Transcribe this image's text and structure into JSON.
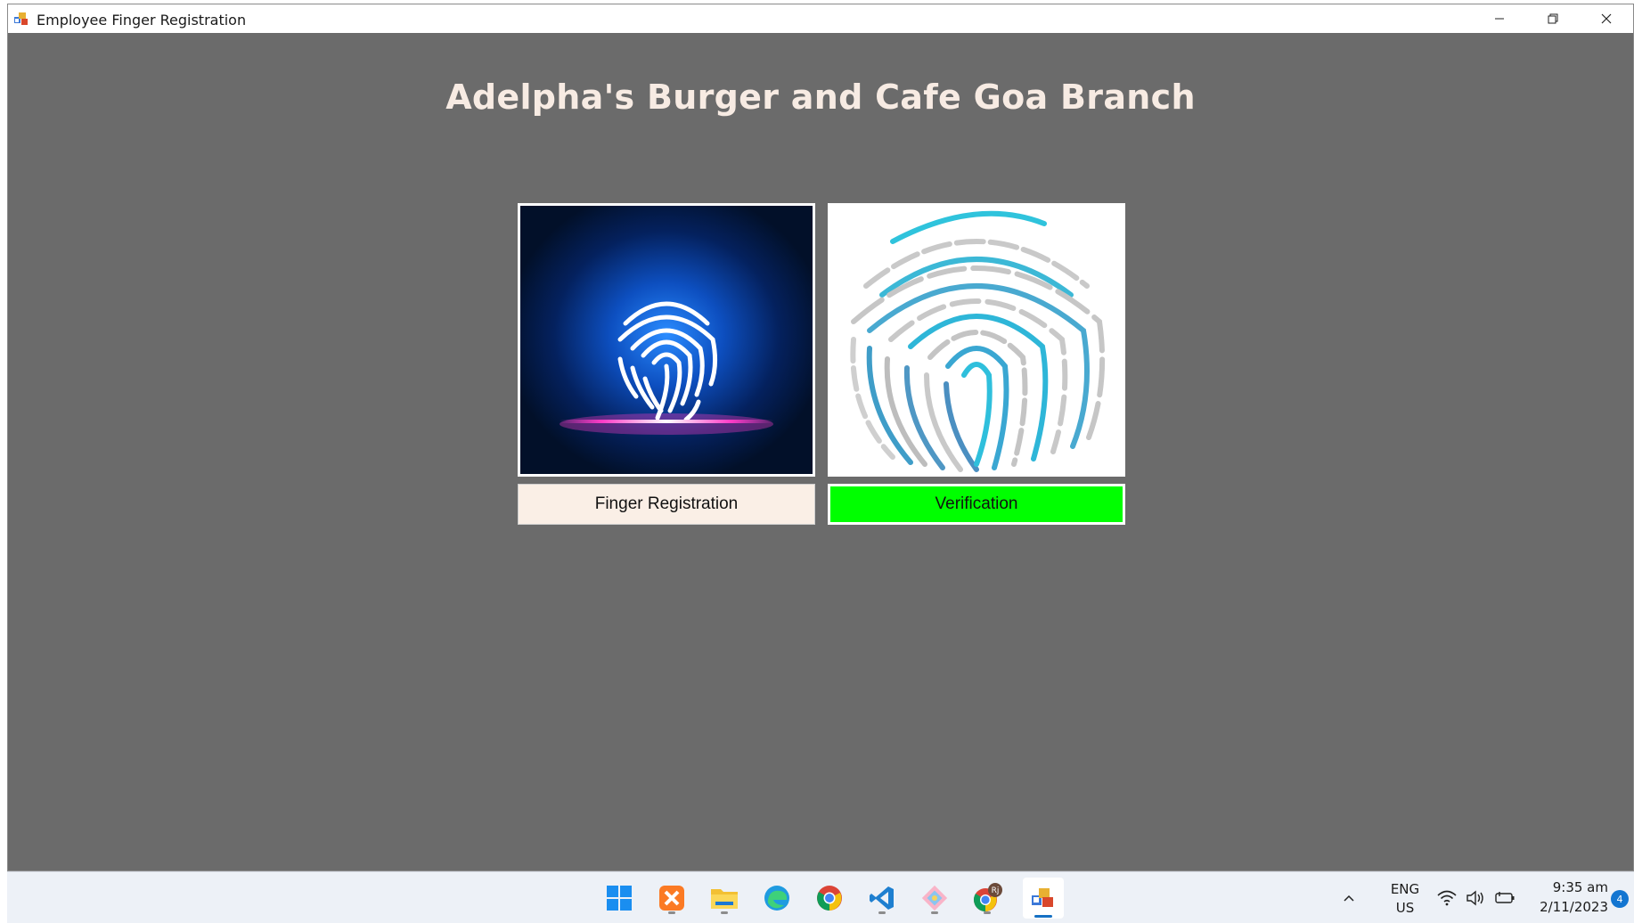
{
  "window": {
    "title": "Employee Finger Registration",
    "icons": [
      "app-icon",
      "minimize-icon",
      "restore-icon",
      "close-icon"
    ]
  },
  "main": {
    "heading": "Adelpha's Burger and Cafe Goa Branch",
    "tiles": [
      {
        "icon": "neon-fingerprint-icon"
      },
      {
        "icon": "fingerprint-scan-icon"
      }
    ],
    "buttons": {
      "registration_label": "Finger Registration",
      "verification_label": "Verification"
    },
    "colors": {
      "background": "#6b6b6b",
      "heading": "#f7ebe3",
      "registration_button": "#faefe6",
      "verification_button": "#00ff00"
    }
  },
  "taskbar": {
    "apps": [
      {
        "name": "start-icon",
        "running": false
      },
      {
        "name": "xampp-icon",
        "running": true
      },
      {
        "name": "file-explorer-icon",
        "running": true
      },
      {
        "name": "edge-icon",
        "running": false
      },
      {
        "name": "chrome-icon",
        "running": false
      },
      {
        "name": "vscode-icon",
        "running": true
      },
      {
        "name": "git-icon",
        "running": true
      },
      {
        "name": "chrome-profile-icon",
        "running": true
      },
      {
        "name": "winforms-app-icon",
        "running": true,
        "active": true
      }
    ],
    "tray": {
      "language_top": "ENG",
      "language_bottom": "US",
      "time": "9:35 am",
      "date": "2/11/2023",
      "notification_count": "4",
      "profile_initials": "Rj"
    }
  }
}
